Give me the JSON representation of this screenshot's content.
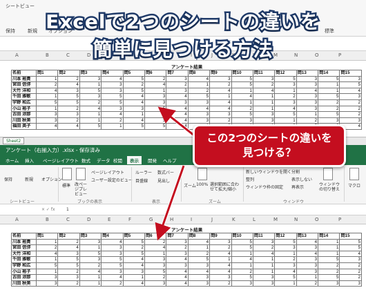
{
  "title": {
    "line1": "Excelで2つのシートの違いを",
    "line2": "簡単に見つける方法"
  },
  "callout": {
    "line1": "この2つのシートの違いを",
    "line2": "見つける？"
  },
  "table": {
    "title": "アンケート結果",
    "header": [
      "名前",
      "問1",
      "問2",
      "問3",
      "問4",
      "問5",
      "問6",
      "問7",
      "問8",
      "問9",
      "問10",
      "問11",
      "問12",
      "問13",
      "問14",
      "問15"
    ],
    "top_rows": [
      [
        "川本 裕貴",
        "1",
        "2",
        "3",
        "4",
        "5",
        "2",
        "3",
        "4",
        "3",
        "5",
        "3",
        "5",
        "3",
        "5",
        "3"
      ],
      [
        "宮田 信弥",
        "2",
        "4",
        "1",
        "3",
        "2",
        "4",
        "2",
        "1",
        "2",
        "5",
        "2",
        "3",
        "3",
        "1",
        "5"
      ],
      [
        "大竹 洋和",
        "4",
        "3",
        "5",
        "3",
        "5",
        "1",
        "3",
        "2",
        "4",
        "1",
        "4",
        "1",
        "4",
        "1",
        "4"
      ],
      [
        "千田 雅敏",
        "1",
        "5",
        "3",
        "5",
        "4",
        "3",
        "4",
        "5",
        "1",
        "4",
        "1",
        "2",
        "3",
        "5",
        "3"
      ],
      [
        "宇野 和広",
        "5",
        "5",
        "2",
        "5",
        "4",
        "3",
        "3",
        "3",
        "4",
        "1",
        "1",
        "3",
        "3",
        "2",
        "2"
      ],
      [
        "小山 裕子",
        "1",
        "2",
        "4",
        "3",
        "3",
        "5",
        "4",
        "4",
        "4",
        "2",
        "1",
        "4",
        "3",
        "2",
        "2"
      ],
      [
        "古田 涼那",
        "3",
        "3",
        "1",
        "4",
        "1",
        "2",
        "4",
        "3",
        "3",
        "5",
        "3",
        "5",
        "1",
        "5",
        "2"
      ],
      [
        "川田 秋美",
        "3",
        "2",
        "1",
        "2",
        "4",
        "3",
        "4",
        "3",
        "2",
        "3",
        "3",
        "1",
        "2",
        "3",
        "3"
      ],
      [
        "福田 英子",
        "4",
        "4",
        "5",
        "1",
        "5",
        "5",
        "4",
        "1",
        "2",
        "1",
        "1",
        "3",
        "5",
        "3",
        "4"
      ]
    ],
    "bottom_rows": [
      [
        "川本 裕貴",
        "1",
        "2",
        "3",
        "4",
        "5",
        "2",
        "3",
        "4",
        "3",
        "5",
        "3",
        "5",
        "4",
        "1",
        "5"
      ],
      [
        "宮田 信弥",
        "2",
        "4",
        "1",
        "3",
        "2",
        "4",
        "2",
        "1",
        "2",
        "5",
        "2",
        "3",
        "3",
        "1",
        "5"
      ],
      [
        "大竹 洋和",
        "4",
        "3",
        "5",
        "3",
        "5",
        "1",
        "3",
        "2",
        "4",
        "1",
        "4",
        "1",
        "4",
        "1",
        "4"
      ],
      [
        "千田 雅敏",
        "1",
        "5",
        "3",
        "5",
        "4",
        "3",
        "4",
        "5",
        "1",
        "4",
        "1",
        "2",
        "3",
        "5",
        "3"
      ],
      [
        "宇野 和広",
        "5",
        "5",
        "2",
        "5",
        "4",
        "3",
        "3",
        "3",
        "4",
        "1",
        "1",
        "3",
        "3",
        "2",
        "2"
      ],
      [
        "小山 裕子",
        "1",
        "2",
        "4",
        "3",
        "3",
        "5",
        "4",
        "4",
        "4",
        "2",
        "1",
        "4",
        "3",
        "2",
        "2"
      ],
      [
        "古田 涼那",
        "3",
        "3",
        "1",
        "4",
        "1",
        "2",
        "4",
        "3",
        "3",
        "5",
        "3",
        "5",
        "1",
        "5",
        "2"
      ],
      [
        "川田 秋美",
        "3",
        "2",
        "1",
        "2",
        "4",
        "3",
        "4",
        "3",
        "2",
        "3",
        "3",
        "1",
        "2",
        "3",
        "3"
      ]
    ]
  },
  "top_window": {
    "columns": [
      "A",
      "B",
      "C",
      "D",
      "E",
      "F",
      "G",
      "H",
      "I",
      "J",
      "K",
      "L",
      "M",
      "N",
      "O",
      "P"
    ],
    "sheet_tab": "Sheet2",
    "toolbar": [
      "シートビュー",
      "保持",
      "新規",
      "オプション",
      "標準",
      "改ページプレビュー"
    ]
  },
  "bottom_window": {
    "title": "アンケート（右揃入力）.xlsx - 保存済み",
    "tabs": [
      "ホーム",
      "挿入",
      "ページレイアウト",
      "数式",
      "データ",
      "校閲",
      "表示",
      "開発",
      "ヘルプ"
    ],
    "active_tab": "表示",
    "ribbon": {
      "sheetview": [
        "保持",
        "新規",
        "オプション"
      ],
      "sheetview_group": "シートビュー",
      "book": [
        "標準",
        "改ページプレビュー",
        "ページレイアウト",
        "ユーザー設定のビュー"
      ],
      "book_group": "ブックの表示",
      "show": [
        "ルーラー",
        "目盛線",
        "数式バー",
        "見出し"
      ],
      "show_group": "表示",
      "zoom": [
        "ズーム",
        "100%",
        "選択範囲に合わせて拡大/縮小"
      ],
      "zoom_group": "ズーム",
      "window": [
        "新しいウィンドウを開く",
        "整列",
        "ウィンドウ枠の固定",
        "分割",
        "表示しない",
        "再表示"
      ],
      "window_group": "ウィンドウ",
      "switch": "ウィンドウの切り替え",
      "macro": "マクロ"
    },
    "columns": [
      "A",
      "B",
      "C",
      "D",
      "E",
      "F",
      "G",
      "H",
      "I",
      "J",
      "K",
      "L",
      "M",
      "N",
      "O",
      "P"
    ],
    "formula_value": "1"
  },
  "colors": {
    "title_stroke": "#1f3a68",
    "callout": "#c40e1f",
    "excel_green": "#207245",
    "arrow": "#c40e1f"
  }
}
